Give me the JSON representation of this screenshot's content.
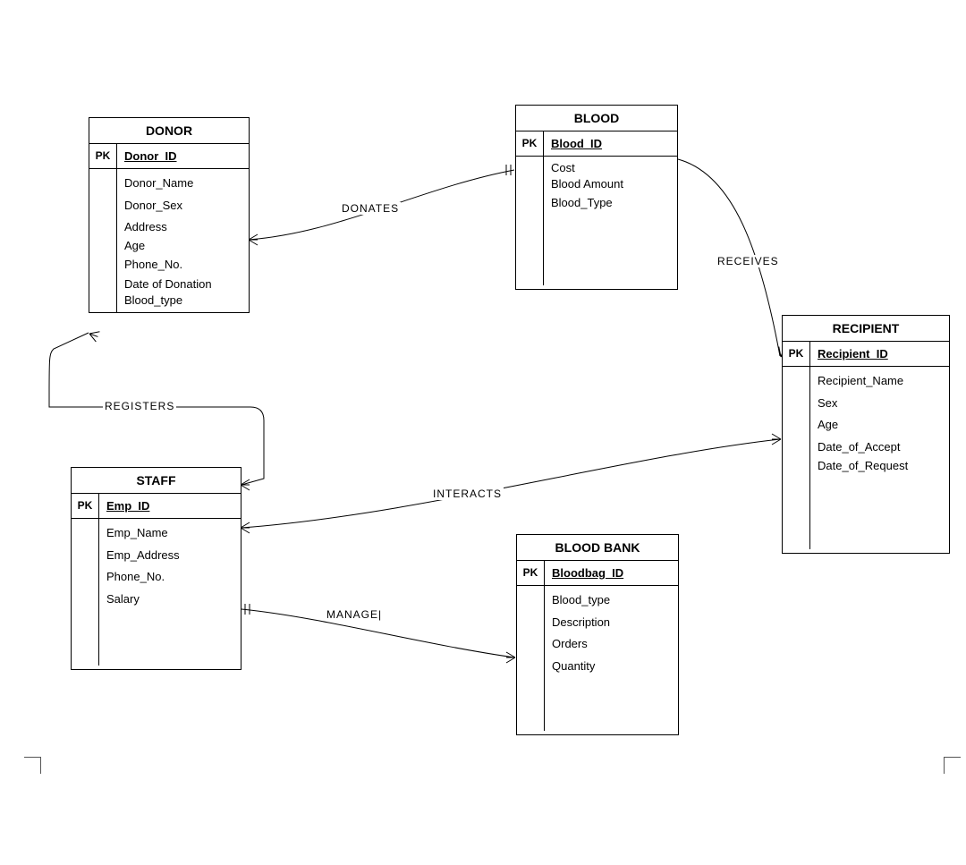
{
  "entities": {
    "donor": {
      "title": "DONOR",
      "pk_label": "PK",
      "pk_attr": "Donor_ID",
      "attrs": [
        "Donor_Name",
        "Donor_Sex",
        "Address",
        "Age",
        "Phone_No.",
        "Date of Donation",
        "Blood_type"
      ]
    },
    "blood": {
      "title": "BLOOD",
      "pk_label": "PK",
      "pk_attr": "Blood_ID",
      "attrs": [
        "Cost",
        "Blood Amount",
        "Blood_Type"
      ]
    },
    "recipient": {
      "title": "RECIPIENT",
      "pk_label": "PK",
      "pk_attr": "Recipient_ID",
      "attrs": [
        "Recipient_Name",
        "Sex",
        "Age",
        "Date_of_Accept",
        "Date_of_Request"
      ]
    },
    "staff": {
      "title": "STAFF",
      "pk_label": "PK",
      "pk_attr": "Emp_ID",
      "attrs": [
        "Emp_Name",
        "Emp_Address",
        "Phone_No.",
        "Salary"
      ]
    },
    "bloodbank": {
      "title": "BLOOD BANK",
      "pk_label": "PK",
      "pk_attr": "Bloodbag_ID",
      "attrs": [
        "Blood_type",
        "Description",
        "Orders",
        "Quantity"
      ]
    }
  },
  "relationships": {
    "donates": {
      "label": "DONATES",
      "from": "donor",
      "to": "blood"
    },
    "receives": {
      "label": "RECEIVES",
      "from": "blood",
      "to": "recipient"
    },
    "registers": {
      "label": "REGISTERS",
      "from": "staff",
      "to": "donor"
    },
    "interacts": {
      "label": "INTERACTS",
      "from": "staff",
      "to": "recipient"
    },
    "manages": {
      "label": "MANAGE|",
      "from": "staff",
      "to": "bloodbank"
    }
  }
}
